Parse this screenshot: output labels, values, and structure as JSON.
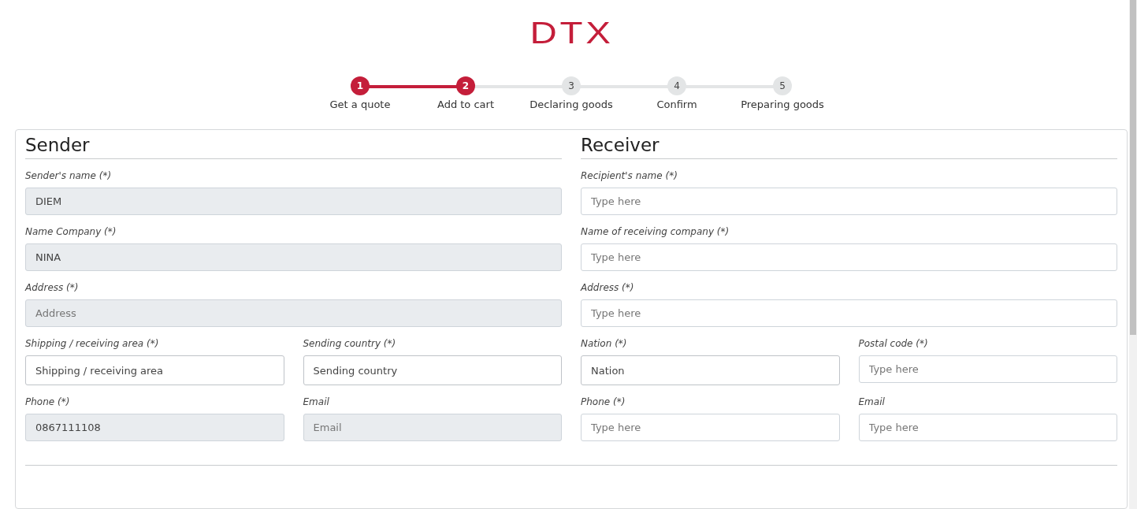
{
  "logo": "DTX",
  "steps": [
    {
      "number": "1",
      "label": "Get a quote",
      "done": true
    },
    {
      "number": "2",
      "label": "Add to cart",
      "done": true
    },
    {
      "number": "3",
      "label": "Declaring goods",
      "done": false
    },
    {
      "number": "4",
      "label": "Confirm",
      "done": false
    },
    {
      "number": "5",
      "label": "Preparing goods",
      "done": false
    }
  ],
  "sections": [
    {
      "title": "Sender",
      "rows": [
        [
          {
            "label": "Sender's name (*)",
            "kind": "text",
            "value": "DIEM",
            "disabled": true
          }
        ],
        [
          {
            "label": "Name Company (*)",
            "kind": "text",
            "value": "NINA",
            "disabled": true
          }
        ],
        [
          {
            "label": "Address (*)",
            "kind": "text",
            "placeholder": "Address",
            "disabled": true
          }
        ],
        [
          {
            "label": "Shipping / receiving area (*)",
            "kind": "select",
            "value": "Shipping / receiving area",
            "disabled": false
          },
          {
            "label": "Sending country (*)",
            "kind": "select",
            "value": "Sending country",
            "disabled": false
          }
        ],
        [
          {
            "label": "Phone (*)",
            "kind": "text",
            "value": "0867111108",
            "disabled": true
          },
          {
            "label": "Email",
            "kind": "text",
            "placeholder": "Email",
            "disabled": true
          }
        ]
      ]
    },
    {
      "title": "Receiver",
      "rows": [
        [
          {
            "label": "Recipient's name (*)",
            "kind": "text",
            "placeholder": "Type here",
            "disabled": false
          }
        ],
        [
          {
            "label": "Name of receiving company (*)",
            "kind": "text",
            "placeholder": "Type here",
            "disabled": false
          }
        ],
        [
          {
            "label": "Address (*)",
            "kind": "text",
            "placeholder": "Type here",
            "disabled": false
          }
        ],
        [
          {
            "label": "Nation (*)",
            "kind": "select",
            "value": "Nation",
            "disabled": false
          },
          {
            "label": "Postal code (*)",
            "kind": "text",
            "placeholder": "Type here",
            "disabled": false
          }
        ],
        [
          {
            "label": "Phone (*)",
            "kind": "text",
            "placeholder": "Type here",
            "disabled": false
          },
          {
            "label": "Email",
            "kind": "text",
            "placeholder": "Type here",
            "disabled": false
          }
        ]
      ]
    }
  ]
}
